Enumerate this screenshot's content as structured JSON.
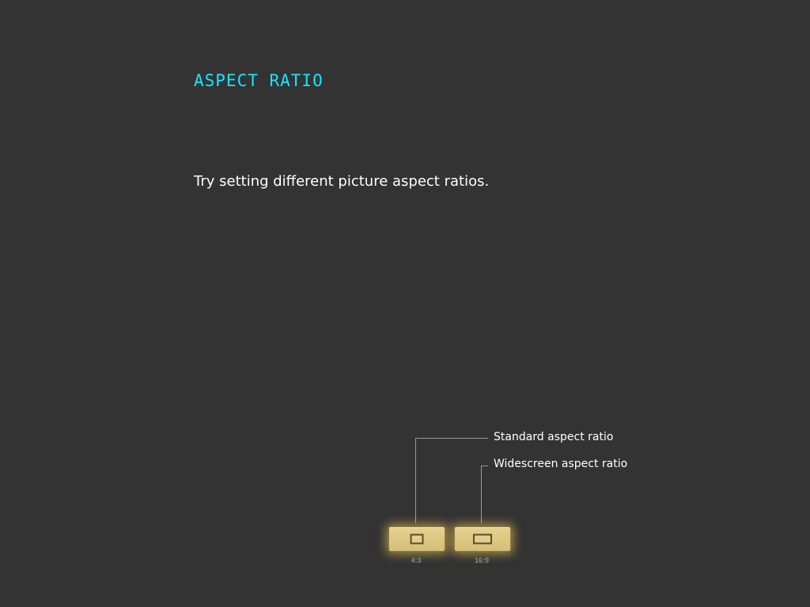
{
  "title": "Aspect Ratio",
  "instructions": "Try setting different picture aspect ratios.",
  "callouts": {
    "standard": "Standard aspect ratio",
    "widescreen": "Widescreen aspect ratio"
  },
  "buttons": [
    {
      "label": "4:3",
      "icon": "standard-aspect-icon"
    },
    {
      "label": "16:9",
      "icon": "widescreen-aspect-icon"
    }
  ],
  "colors": {
    "background": "#333333",
    "title": "#11e6ff",
    "button": "#e0cb86",
    "text": "#ffffff"
  }
}
